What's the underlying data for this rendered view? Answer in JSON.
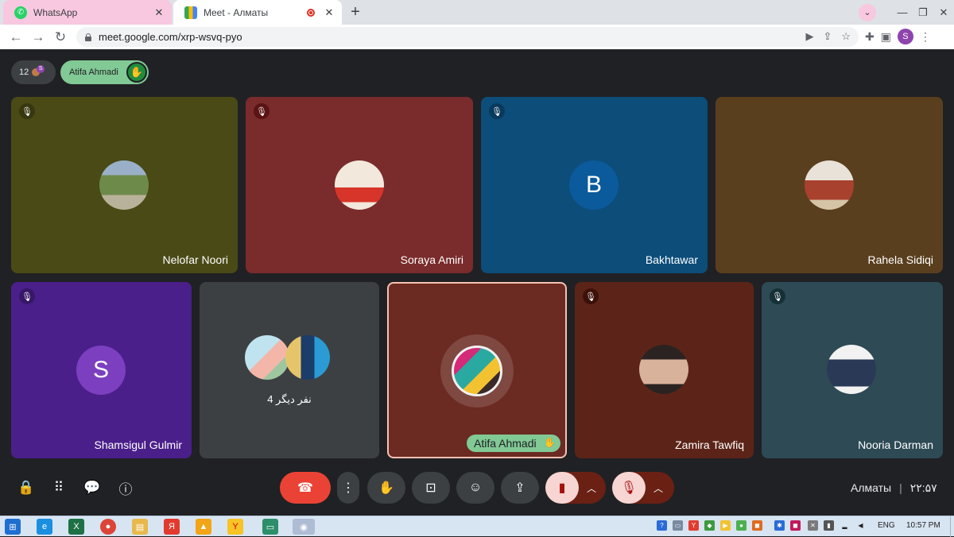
{
  "tabs": [
    {
      "title": "WhatsApp",
      "icon": "whatsapp-icon"
    },
    {
      "title": "Meet - Алматы",
      "icon": "google-meet-icon"
    }
  ],
  "address_bar": {
    "url": "meet.google.com/xrp-wsvq-pyo"
  },
  "profile_initial": "S",
  "top_bar": {
    "participant_count": "12",
    "participant_initial": "S",
    "raised_hand_name": "Atifa Ahmadi"
  },
  "tiles": [
    {
      "name": "Nelofar Noori",
      "muted": true,
      "avatar": "photo",
      "bg": "#4a4a16"
    },
    {
      "name": "Soraya Amiri",
      "muted": true,
      "avatar": "photo",
      "bg": "#7a2b2b"
    },
    {
      "name": "Bakhtawar",
      "muted": true,
      "avatar_letter": "B",
      "bg": "#0c4d7a"
    },
    {
      "name": "Rahela Sidiqi",
      "muted": false,
      "avatar": "photo",
      "bg": "#5a3f1e"
    },
    {
      "name": "Shamsigul Gulmir",
      "muted": true,
      "avatar_letter": "S",
      "bg": "#4a1f8a"
    },
    {
      "others_label": "4 نفر دیگر",
      "bg": "#3c4043"
    },
    {
      "name": "Atifa Ahmadi",
      "active_speaker": true,
      "hand_raised": true,
      "bg": "#6b2a22"
    },
    {
      "name": "Zamira Tawfiq",
      "muted": true,
      "avatar": "photo",
      "bg": "#5c2418"
    },
    {
      "name": "Nooria Darman",
      "muted": true,
      "avatar": "photo",
      "bg": "#2d4a55"
    }
  ],
  "meeting": {
    "location": "Алматы",
    "time": "۲۲:۵۷"
  },
  "taskbar": {
    "language": "ENG",
    "time": "10:57 PM"
  },
  "colors": {
    "hangup": "#ea4335",
    "camera_off": "#f6d5d2",
    "hand_green": "#81c995"
  }
}
